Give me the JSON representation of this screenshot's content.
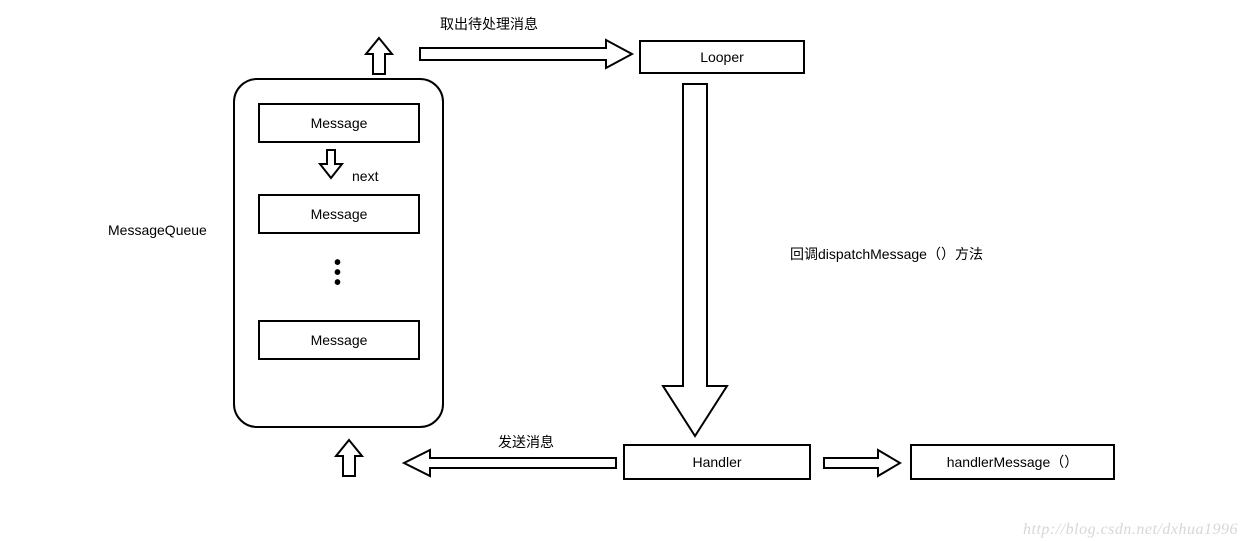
{
  "labels": {
    "messageQueue": "MessageQueue",
    "next": "next",
    "takeMsg": "取出待处理消息",
    "sendMsg": "发送消息",
    "dispatch": "回调dispatchMessage（）方法"
  },
  "boxes": {
    "message1": "Message",
    "message2": "Message",
    "message3": "Message",
    "looper": "Looper",
    "handler": "Handler",
    "handlerMessage": "handlerMessage（）"
  },
  "watermark": "http://blog.csdn.net/dxhua1996"
}
